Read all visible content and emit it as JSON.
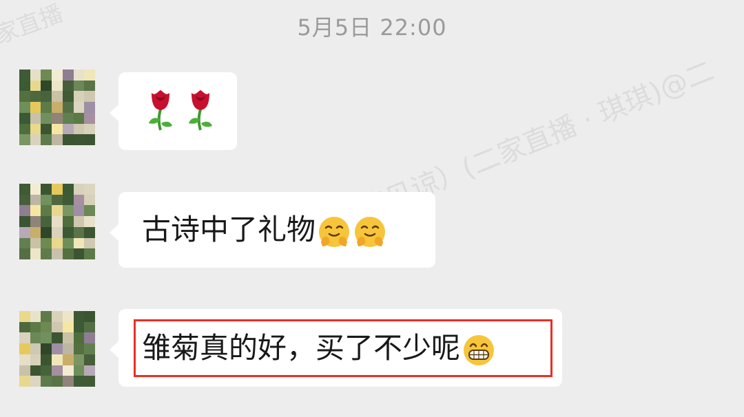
{
  "timestamp": "5月5日 22:00",
  "watermark": {
    "main": "（回复慢，请见谅）(二家直播 · 琪琪)@二",
    "corner": "家直播"
  },
  "messages": [
    {
      "sender_avatar_icon": "blurred-flower-avatar",
      "content_type": "emoji",
      "emojis": [
        "rose-icon",
        "rose-icon"
      ]
    },
    {
      "sender_avatar_icon": "blurred-flower-avatar",
      "content_type": "text",
      "text": "古诗中了礼物",
      "trailing_emojis": [
        "hugging-face-icon",
        "hugging-face-icon"
      ]
    },
    {
      "sender_avatar_icon": "blurred-flower-avatar",
      "content_type": "text",
      "text": "雏菊真的好，买了不少呢",
      "trailing_emojis": [
        "grinning-face-icon"
      ],
      "highlighted": true
    }
  ],
  "colors": {
    "background": "#ededed",
    "bubble": "#ffffff",
    "highlight_border": "#ea2e24",
    "timestamp": "#9a9a9a"
  }
}
